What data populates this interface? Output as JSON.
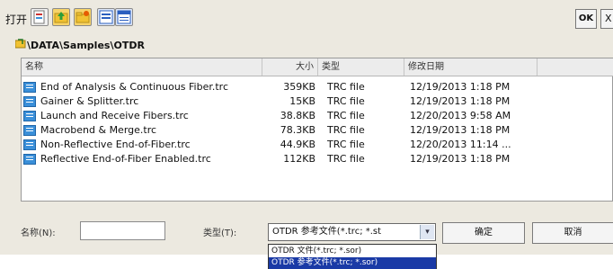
{
  "window": {
    "title": "打开",
    "ok_label": "OK",
    "close_label": "X"
  },
  "toolbar": {
    "icons": [
      "new-file-icon",
      "up-folder-icon",
      "new-folder-icon",
      "view-list-icon",
      "view-details-icon"
    ]
  },
  "path": "\\DATA\\Samples\\OTDR",
  "columns": {
    "name": "名称",
    "size": "大小",
    "type": "类型",
    "date": "修改日期"
  },
  "files": [
    {
      "name": "End of Analysis & Continuous Fiber.trc",
      "size": "359KB",
      "type": "TRC file",
      "date": "12/19/2013 1:18 PM"
    },
    {
      "name": "Gainer & Splitter.trc",
      "size": "15KB",
      "type": "TRC file",
      "date": "12/19/2013 1:18 PM"
    },
    {
      "name": "Launch and Receive Fibers.trc",
      "size": "38.8KB",
      "type": "TRC file",
      "date": "12/20/2013 9:58 AM"
    },
    {
      "name": "Macrobend & Merge.trc",
      "size": "78.3KB",
      "type": "TRC file",
      "date": "12/19/2013 1:18 PM"
    },
    {
      "name": "Non-Reflective End-of-Fiber.trc",
      "size": "44.9KB",
      "type": "TRC file",
      "date": "12/20/2013 11:14 ..."
    },
    {
      "name": "Reflective End-of-Fiber Enabled.trc",
      "size": "112KB",
      "type": "TRC file",
      "date": "12/19/2013 1:18 PM"
    }
  ],
  "bottom": {
    "filename_label": "名称(N):",
    "filename_value": "",
    "filetype_label": "类型(T):",
    "filetype_selected": "OTDR 参考文件(*.trc; *.st",
    "confirm_label": "确定",
    "cancel_label": "取消"
  },
  "dropdown": {
    "options": [
      {
        "label": "OTDR 文件(*.trc; *.sor)",
        "active": false
      },
      {
        "label": "OTDR 参考文件(*.trc; *.sor)",
        "active": true
      }
    ]
  }
}
